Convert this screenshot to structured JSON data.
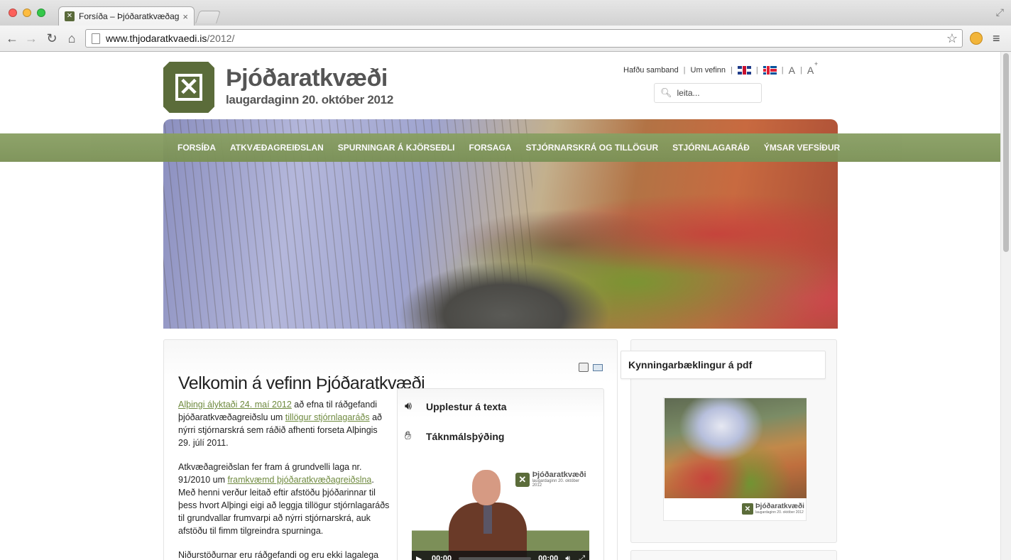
{
  "browser": {
    "tab_title": "Forsíða – Þjóðaratkvæðagr",
    "url_domain": "www.thjodaratkvaedi.is",
    "url_path": "/2012/"
  },
  "header": {
    "logo_title": "Þjóðaratkvæði",
    "logo_subtitle": "laugardaginn 20. október 2012",
    "links": [
      "Hafðu samband",
      "Um vefinn"
    ],
    "font_normal": "A",
    "font_larger": "A",
    "font_plus": "+",
    "search_placeholder": "leita..."
  },
  "nav": {
    "items": [
      "Forsíða",
      "Atkvæðagreiðslan",
      "Spurningar á kjörseðli",
      "Forsaga",
      "Stjórnarskrá og tillögur",
      "Stjórnlagaráð",
      "Ýmsar vefsíður"
    ]
  },
  "main": {
    "title": "Velkomin á vefinn Þjóðaratkvæði",
    "p1": {
      "link1": "Alþingi ályktaði 24. maí 2012",
      "text1": " að efna til ráðgefandi þjóðaratkvæðagreiðslu um ",
      "link2": "tillögur stjórnlagaráðs",
      "text2": " að nýrri stjórnarskrá sem ráðið afhenti forseta Alþingis 29. júlí 2011."
    },
    "p2": {
      "text1": "Atkvæðagreiðslan fer fram á grundvelli laga nr. 91/2010 um ",
      "link1": "framkvæmd þjóðaratkvæðagreiðslna",
      "text2": ". Með henni verður leitað eftir afstöðu þjóðarinnar til þess hvort Alþingi eigi að leggja tillögur stjórnlagaráðs til grundvallar frumvarpi að nýrri stjórnarskrá, auk afstöðu til fimm tilgreindra spurninga."
    },
    "p3": "Niðurstöðurnar eru ráðgefandi og eru ekki lagalega"
  },
  "media": {
    "read_aloud": "Upplestur á texta",
    "sign_language": "Táknmálsþýðing",
    "video_logo_title": "Þjóðaratkvæði",
    "video_logo_sub": "laugardaginn 20. október 2012",
    "time_current": "00:00",
    "time_total": "00:00"
  },
  "sidebar": {
    "title": "Kynningarbæklingur á pdf",
    "logo_title": "Þjóðaratkvæði",
    "logo_sub": "laugardaginn 20. október 2012"
  }
}
